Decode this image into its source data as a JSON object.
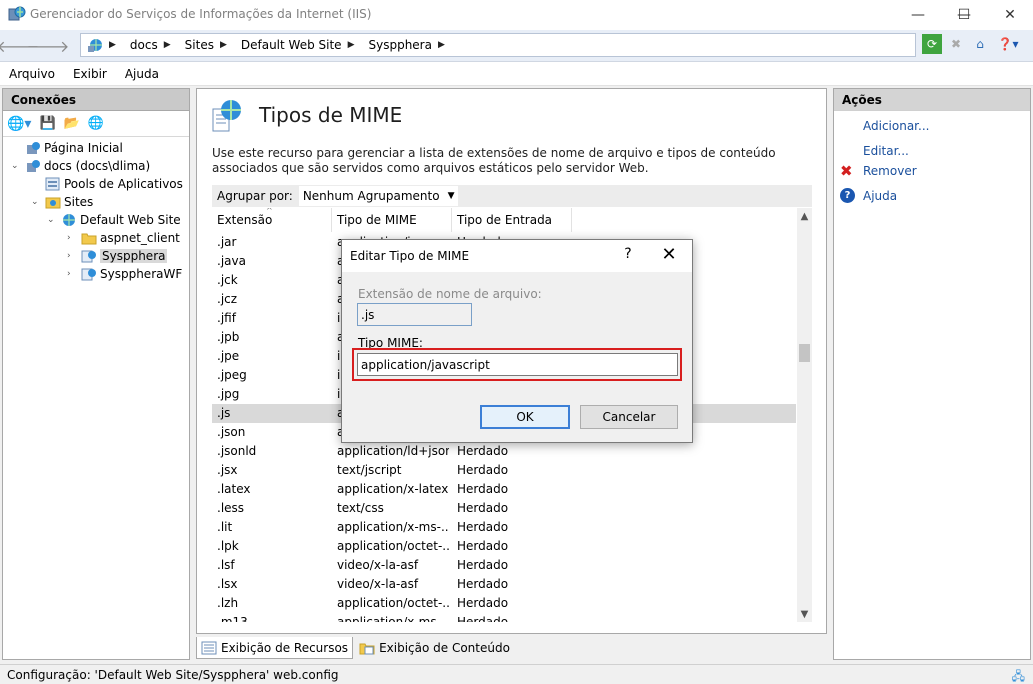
{
  "window": {
    "title": "Gerenciador do Serviços de Informações da Internet (IIS)",
    "minimize": "—",
    "maximize": "☐",
    "close": "✕"
  },
  "address": {
    "crumbs": [
      "docs",
      "Sites",
      "Default Web Site",
      "Syspphera"
    ]
  },
  "menu": {
    "items": [
      "Arquivo",
      "Exibir",
      "Ajuda"
    ]
  },
  "connections": {
    "header": "Conexões",
    "tree": [
      {
        "label": "Página Inicial",
        "toggle": ""
      },
      {
        "label": "docs (docs\\dlima)",
        "toggle": "⌄"
      },
      {
        "label": "Pools de Aplicativos",
        "toggle": ""
      },
      {
        "label": "Sites",
        "toggle": "⌄"
      },
      {
        "label": "Default Web Site",
        "toggle": "⌄"
      },
      {
        "label": "aspnet_client",
        "toggle": "›"
      },
      {
        "label": "Syspphera",
        "toggle": "›"
      },
      {
        "label": "SysppheraWF",
        "toggle": "›"
      }
    ]
  },
  "main": {
    "title": "Tipos de MIME",
    "description": "Use este recurso para gerenciar a lista de extensões de nome de arquivo e tipos de conteúdo associados que são servidos como arquivos estáticos pelo servidor Web.",
    "group_label": "Agrupar por:",
    "group_value": "Nenhum Agrupamento",
    "columns": [
      "Extensão",
      "Tipo de MIME",
      "Tipo de Entrada"
    ],
    "rows": [
      {
        "ext": ".jar",
        "mime": "application/java-a...",
        "type": "Herdado"
      },
      {
        "ext": ".java",
        "mime": "a",
        "type": ""
      },
      {
        "ext": ".jck",
        "mime": "a",
        "type": ""
      },
      {
        "ext": ".jcz",
        "mime": "a",
        "type": ""
      },
      {
        "ext": ".jfif",
        "mime": "i",
        "type": ""
      },
      {
        "ext": ".jpb",
        "mime": "a",
        "type": ""
      },
      {
        "ext": ".jpe",
        "mime": "i",
        "type": ""
      },
      {
        "ext": ".jpeg",
        "mime": "i",
        "type": ""
      },
      {
        "ext": ".jpg",
        "mime": "i",
        "type": ""
      },
      {
        "ext": ".js",
        "mime": "a",
        "type": ""
      },
      {
        "ext": ".json",
        "mime": "a",
        "type": ""
      },
      {
        "ext": ".jsonld",
        "mime": "application/ld+json",
        "type": "Herdado"
      },
      {
        "ext": ".jsx",
        "mime": "text/jscript",
        "type": "Herdado"
      },
      {
        "ext": ".latex",
        "mime": "application/x-latex",
        "type": "Herdado"
      },
      {
        "ext": ".less",
        "mime": "text/css",
        "type": "Herdado"
      },
      {
        "ext": ".lit",
        "mime": "application/x-ms-...",
        "type": "Herdado"
      },
      {
        "ext": ".lpk",
        "mime": "application/octet-...",
        "type": "Herdado"
      },
      {
        "ext": ".lsf",
        "mime": "video/x-la-asf",
        "type": "Herdado"
      },
      {
        "ext": ".lsx",
        "mime": "video/x-la-asf",
        "type": "Herdado"
      },
      {
        "ext": ".lzh",
        "mime": "application/octet-...",
        "type": "Herdado"
      },
      {
        "ext": ".m13",
        "mime": "application/x-ms...",
        "type": "Herdado"
      }
    ],
    "selected_row": 9
  },
  "view_tabs": [
    "Exibição de Recursos",
    "Exibição de Conteúdo"
  ],
  "actions": {
    "header": "Ações",
    "items": [
      "Adicionar...",
      "Editar...",
      "Remover",
      "Ajuda"
    ]
  },
  "status": {
    "text": "Configuração: 'Default Web Site/Syspphera' web.config"
  },
  "dialog": {
    "title": "Editar Tipo de MIME",
    "help": "?",
    "close": "✕",
    "ext_label": "Extensão de nome de arquivo:",
    "ext_value": ".js",
    "mime_label": "Tipo MIME:",
    "mime_value": "application/javascript",
    "ok": "OK",
    "cancel": "Cancelar"
  },
  "colors": {
    "link": "#1a4f9c",
    "highlight": "#d81e1e",
    "selection": "#d9d9d9"
  }
}
